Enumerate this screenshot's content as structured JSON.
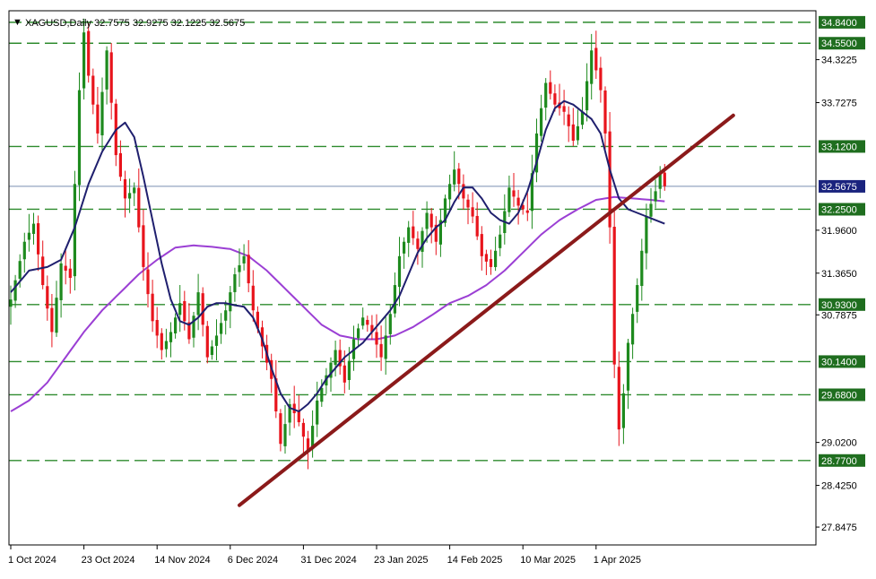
{
  "header": {
    "menu_glyph": "▼",
    "symbol_line": "XAGUSD,Daily  32.7575 32.9275 32.1225 32.5675"
  },
  "colors": {
    "bull": "#1e8a1e",
    "bear": "#e8141c",
    "level_line": "#2e8b2e",
    "level_tag_bg": "#1f6e1f",
    "trendline": "#8b1a1a",
    "ma_fast": "#1f1f6e",
    "ma_slow": "#9b3fd4",
    "current_price_line": "#7a8fb0",
    "current_price_tag_bg": "#1a237e"
  },
  "chart_data": {
    "type": "candlestick",
    "title": "XAGUSD,Daily",
    "ohlc_readout": {
      "open": 32.7575,
      "high": 32.9275,
      "low": 32.1225,
      "close": 32.5675
    },
    "ylim": [
      27.6,
      35.0
    ],
    "axis_ticks": [
      "34.3225",
      "33.7275",
      "31.9600",
      "31.3650",
      "30.7875",
      "29.0200",
      "28.4250",
      "27.8475"
    ],
    "axis_tick_values": [
      34.3225,
      33.7275,
      31.96,
      31.365,
      30.7875,
      29.02,
      28.425,
      27.8475
    ],
    "levels": [
      {
        "label": "34.8400",
        "value": 34.84
      },
      {
        "label": "34.5500",
        "value": 34.55
      },
      {
        "label": "33.1200",
        "value": 33.12
      },
      {
        "label": "32.2500",
        "value": 32.25
      },
      {
        "label": "30.9300",
        "value": 30.93
      },
      {
        "label": "30.1400",
        "value": 30.14
      },
      {
        "label": "29.6800",
        "value": 29.68
      },
      {
        "label": "28.7700",
        "value": 28.77
      }
    ],
    "current_price": {
      "label": "32.5675",
      "value": 32.5675
    },
    "x_labels": [
      "1 Oct 2024",
      "23 Oct 2024",
      "14 Nov 2024",
      "6 Dec 2024",
      "31 Dec 2024",
      "23 Jan 2025",
      "14 Feb 2025",
      "10 Mar 2025",
      "1 Apr 2025"
    ],
    "x_label_bars": [
      0,
      16,
      32,
      48,
      64,
      80,
      96,
      112,
      128
    ],
    "trendline": {
      "from": {
        "bar": 50,
        "value": 28.15
      },
      "to": {
        "bar": 158,
        "value": 33.55
      }
    },
    "close_anchors": [
      [
        0,
        31.0
      ],
      [
        3,
        31.8
      ],
      [
        5,
        32.05
      ],
      [
        7,
        31.2
      ],
      [
        9,
        30.55
      ],
      [
        11,
        31.5
      ],
      [
        13,
        31.3
      ],
      [
        15,
        33.9
      ],
      [
        16,
        34.7
      ],
      [
        17,
        34.1
      ],
      [
        19,
        33.3
      ],
      [
        21,
        34.45
      ],
      [
        23,
        33.0
      ],
      [
        25,
        32.4
      ],
      [
        27,
        32.55
      ],
      [
        29,
        31.45
      ],
      [
        31,
        30.7
      ],
      [
        33,
        30.3
      ],
      [
        35,
        30.55
      ],
      [
        37,
        30.95
      ],
      [
        39,
        30.45
      ],
      [
        41,
        31.1
      ],
      [
        43,
        30.2
      ],
      [
        45,
        30.5
      ],
      [
        47,
        30.85
      ],
      [
        49,
        31.35
      ],
      [
        51,
        31.6
      ],
      [
        53,
        30.85
      ],
      [
        55,
        30.35
      ],
      [
        57,
        29.9
      ],
      [
        59,
        29.0
      ],
      [
        61,
        29.55
      ],
      [
        63,
        29.3
      ],
      [
        65,
        28.9
      ],
      [
        67,
        29.6
      ],
      [
        69,
        29.95
      ],
      [
        71,
        30.3
      ],
      [
        73,
        29.85
      ],
      [
        75,
        30.45
      ],
      [
        77,
        30.75
      ],
      [
        79,
        30.55
      ],
      [
        81,
        30.2
      ],
      [
        83,
        30.8
      ],
      [
        85,
        31.6
      ],
      [
        87,
        32.0
      ],
      [
        89,
        31.7
      ],
      [
        91,
        32.2
      ],
      [
        93,
        31.8
      ],
      [
        95,
        32.4
      ],
      [
        97,
        32.8
      ],
      [
        99,
        32.4
      ],
      [
        101,
        32.15
      ],
      [
        103,
        31.6
      ],
      [
        105,
        31.45
      ],
      [
        107,
        31.9
      ],
      [
        109,
        32.55
      ],
      [
        111,
        32.3
      ],
      [
        113,
        32.2
      ],
      [
        115,
        33.3
      ],
      [
        117,
        34.0
      ],
      [
        119,
        33.7
      ],
      [
        121,
        33.6
      ],
      [
        123,
        33.2
      ],
      [
        125,
        33.6
      ],
      [
        127,
        34.45
      ],
      [
        129,
        33.9
      ],
      [
        130,
        33.3
      ],
      [
        131,
        32.0
      ],
      [
        132,
        30.1
      ],
      [
        133,
        29.2
      ],
      [
        134,
        29.7
      ],
      [
        135,
        30.4
      ],
      [
        137,
        31.2
      ],
      [
        139,
        32.15
      ],
      [
        141,
        32.5
      ],
      [
        142,
        32.75
      ],
      [
        143,
        32.57
      ]
    ],
    "ma_fast": [
      [
        0,
        31.1
      ],
      [
        4,
        31.4
      ],
      [
        8,
        31.45
      ],
      [
        11,
        31.55
      ],
      [
        14,
        32.0
      ],
      [
        17,
        32.6
      ],
      [
        20,
        33.05
      ],
      [
        23,
        33.35
      ],
      [
        25,
        33.45
      ],
      [
        27,
        33.25
      ],
      [
        29,
        32.7
      ],
      [
        31,
        32.1
      ],
      [
        33,
        31.5
      ],
      [
        35,
        31.0
      ],
      [
        37,
        30.7
      ],
      [
        39,
        30.65
      ],
      [
        41,
        30.75
      ],
      [
        43,
        30.9
      ],
      [
        45,
        30.95
      ],
      [
        47,
        30.95
      ],
      [
        49,
        30.92
      ],
      [
        51,
        30.9
      ],
      [
        53,
        30.75
      ],
      [
        55,
        30.45
      ],
      [
        57,
        30.05
      ],
      [
        59,
        29.7
      ],
      [
        61,
        29.5
      ],
      [
        63,
        29.45
      ],
      [
        65,
        29.55
      ],
      [
        67,
        29.7
      ],
      [
        69,
        29.9
      ],
      [
        71,
        30.05
      ],
      [
        73,
        30.2
      ],
      [
        75,
        30.3
      ],
      [
        77,
        30.4
      ],
      [
        79,
        30.55
      ],
      [
        81,
        30.7
      ],
      [
        83,
        30.85
      ],
      [
        85,
        31.05
      ],
      [
        87,
        31.35
      ],
      [
        89,
        31.65
      ],
      [
        91,
        31.85
      ],
      [
        93,
        32.0
      ],
      [
        95,
        32.1
      ],
      [
        97,
        32.35
      ],
      [
        99,
        32.55
      ],
      [
        101,
        32.55
      ],
      [
        103,
        32.4
      ],
      [
        105,
        32.2
      ],
      [
        107,
        32.1
      ],
      [
        109,
        32.05
      ],
      [
        111,
        32.2
      ],
      [
        113,
        32.5
      ],
      [
        115,
        32.9
      ],
      [
        117,
        33.35
      ],
      [
        119,
        33.65
      ],
      [
        121,
        33.75
      ],
      [
        123,
        33.7
      ],
      [
        125,
        33.6
      ],
      [
        127,
        33.5
      ],
      [
        129,
        33.3
      ],
      [
        131,
        32.8
      ],
      [
        133,
        32.4
      ],
      [
        135,
        32.25
      ],
      [
        137,
        32.2
      ],
      [
        139,
        32.15
      ],
      [
        141,
        32.1
      ],
      [
        143,
        32.05
      ]
    ],
    "ma_slow": [
      [
        0,
        29.45
      ],
      [
        4,
        29.6
      ],
      [
        8,
        29.85
      ],
      [
        12,
        30.2
      ],
      [
        16,
        30.55
      ],
      [
        20,
        30.85
      ],
      [
        24,
        31.1
      ],
      [
        28,
        31.35
      ],
      [
        32,
        31.55
      ],
      [
        36,
        31.72
      ],
      [
        40,
        31.75
      ],
      [
        44,
        31.73
      ],
      [
        48,
        31.7
      ],
      [
        52,
        31.6
      ],
      [
        56,
        31.4
      ],
      [
        60,
        31.15
      ],
      [
        64,
        30.9
      ],
      [
        68,
        30.65
      ],
      [
        72,
        30.5
      ],
      [
        76,
        30.45
      ],
      [
        80,
        30.45
      ],
      [
        84,
        30.5
      ],
      [
        88,
        30.62
      ],
      [
        92,
        30.78
      ],
      [
        96,
        30.95
      ],
      [
        100,
        31.05
      ],
      [
        104,
        31.2
      ],
      [
        108,
        31.4
      ],
      [
        112,
        31.65
      ],
      [
        116,
        31.9
      ],
      [
        120,
        32.1
      ],
      [
        124,
        32.25
      ],
      [
        128,
        32.38
      ],
      [
        132,
        32.42
      ],
      [
        136,
        32.4
      ],
      [
        140,
        32.38
      ],
      [
        143,
        32.36
      ]
    ]
  }
}
